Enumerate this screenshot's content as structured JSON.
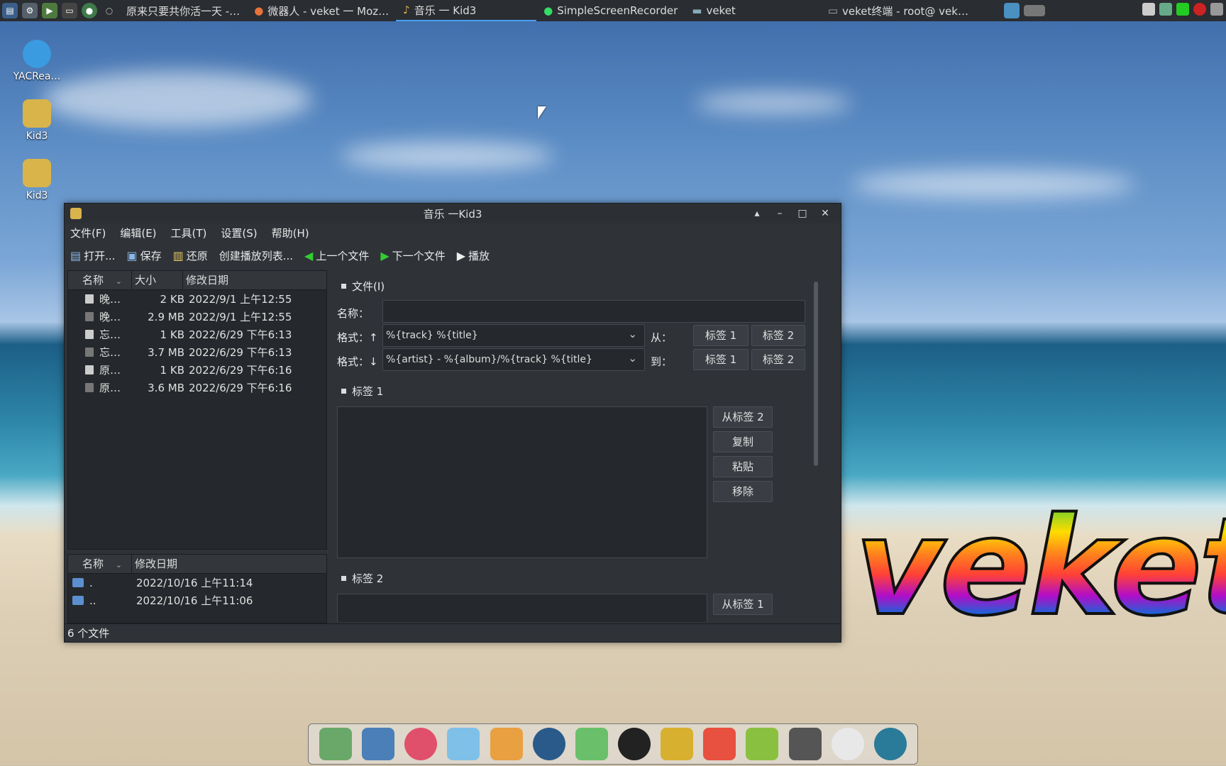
{
  "taskbar": {
    "items": [
      {
        "label": "原来只要共你活一天 -…"
      },
      {
        "label": "微器人 - veket 一 Moz…"
      },
      {
        "label": "音乐 一 Kid3",
        "active": true
      },
      {
        "label": "SimpleScreenRecorder"
      },
      {
        "label": "veket"
      },
      {
        "label": "veket终端 - root@ vek…"
      }
    ]
  },
  "desktop": {
    "icons": [
      {
        "label": "YACRea…"
      },
      {
        "label": "Kid3"
      },
      {
        "label": "Kid3"
      }
    ],
    "logo_text": "veket"
  },
  "window": {
    "title": "音乐 一Kid3",
    "menu": [
      "文件(F)",
      "编辑(E)",
      "工具(T)",
      "设置(S)",
      "帮助(H)"
    ],
    "toolbar": {
      "open": "打开...",
      "save": "保存",
      "revert": "还原",
      "playlist": "创建播放列表...",
      "prev": "上一个文件",
      "next": "下一个文件",
      "play": "播放"
    },
    "file_list": {
      "headers": [
        "名称",
        "大小",
        "修改日期"
      ],
      "rows": [
        {
          "name": "晚…",
          "size": "2 KB",
          "date": "2022/9/1 上午12:55"
        },
        {
          "name": "晚…",
          "size": "2.9 MB",
          "date": "2022/9/1 上午12:55"
        },
        {
          "name": "忘…",
          "size": "1 KB",
          "date": "2022/6/29 下午6:13"
        },
        {
          "name": "忘…",
          "size": "3.7 MB",
          "date": "2022/6/29 下午6:13"
        },
        {
          "name": "原…",
          "size": "1 KB",
          "date": "2022/6/29 下午6:16"
        },
        {
          "name": "原…",
          "size": "3.6 MB",
          "date": "2022/6/29 下午6:16"
        }
      ]
    },
    "dir_list": {
      "headers": [
        "名称",
        "修改日期"
      ],
      "rows": [
        {
          "name": ".",
          "date": "2022/10/16 上午11:14"
        },
        {
          "name": "..",
          "date": "2022/10/16 上午11:06"
        }
      ]
    },
    "status": "6 个文件",
    "file_section": {
      "title": "文件(I)",
      "name_label": "名称：",
      "name_value": "",
      "format_up_label": "格式：↑",
      "format_up_value": "%{track} %{title}",
      "from_label": "从：",
      "format_down_label": "格式：↓",
      "format_down_value": "%{artist} - %{album}/%{track} %{title}",
      "to_label": "到：",
      "tag1": "标签 1",
      "tag2": "标签 2"
    },
    "tag1_section": {
      "title": "标签 1",
      "from_tag2": "从标签 2",
      "copy": "复制",
      "paste": "粘贴",
      "remove": "移除"
    },
    "tag2_section": {
      "title": "标签 2",
      "from_tag1": "从标签 1"
    }
  }
}
